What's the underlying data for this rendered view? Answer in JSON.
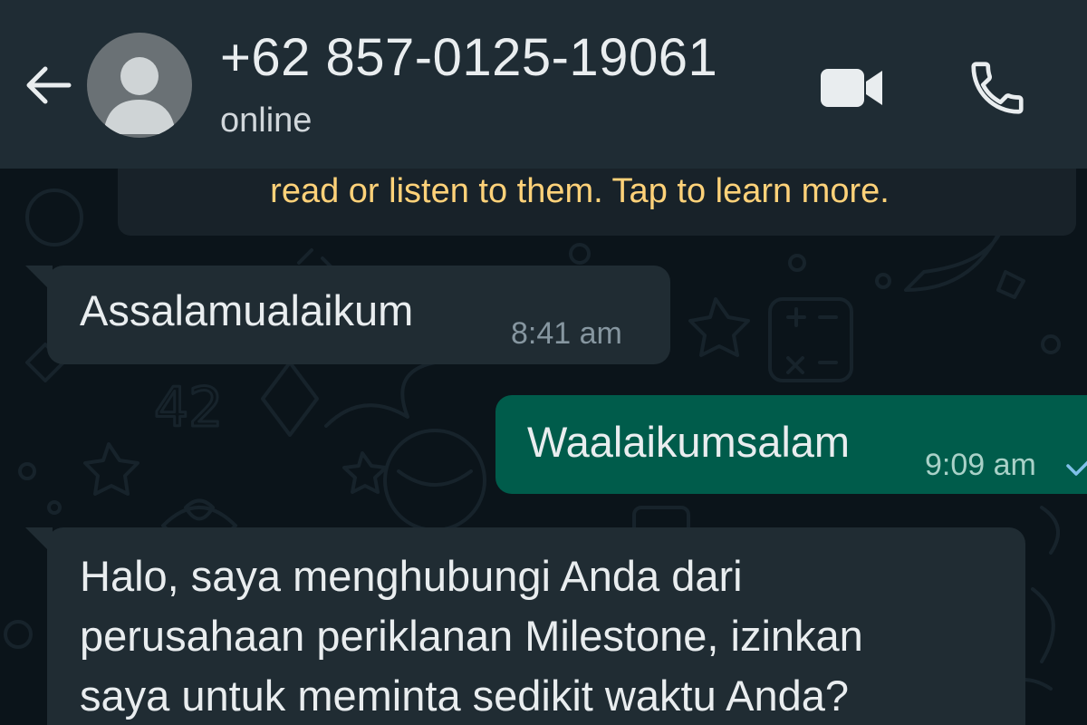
{
  "header": {
    "contact_name": "+62 857-0125-19061",
    "status": "online",
    "icons": {
      "back": "arrow-left-icon",
      "avatar": "default-avatar-icon",
      "video": "video-camera-icon",
      "call": "phone-icon"
    }
  },
  "notice": {
    "text": "read or listen to them. Tap to learn more."
  },
  "messages": [
    {
      "direction": "incoming",
      "lines": [
        "Assalamualaikum"
      ],
      "time": "8:41 am"
    },
    {
      "direction": "outgoing",
      "lines": [
        "Waalaikumsalam"
      ],
      "time": "9:09 am",
      "status_icon": "single-check-icon"
    },
    {
      "direction": "incoming",
      "lines": [
        "Halo, saya menghubungi Anda dari",
        "perusahaan periklanan Milestone, izinkan",
        "saya untuk meminta sedikit waktu Anda?"
      ]
    }
  ],
  "colors": {
    "header_bg": "#1f2c34",
    "chat_bg": "#0b141a",
    "incoming_bubble": "#202c33",
    "outgoing_bubble": "#005c4b",
    "notice_text": "#ffd279",
    "primary_text": "#e9edef",
    "timestamp": "#8696a0"
  }
}
